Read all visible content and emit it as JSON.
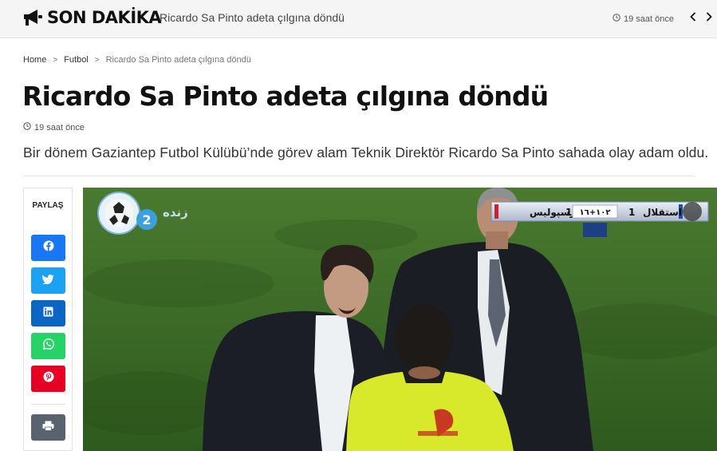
{
  "breaking": {
    "label": "SON DAKİKA",
    "headline": "Ricardo Sa Pinto adeta çılgına döndü",
    "time": "19 saat önce",
    "icons": {
      "megaphone": "megaphone-icon",
      "clock": "clock-icon",
      "prev": "chevron-left-icon",
      "next": "chevron-right-icon"
    }
  },
  "breadcrumb": {
    "home": "Home",
    "category": "Futbol",
    "current": "Ricardo Sa Pinto adeta çılgına döndü"
  },
  "article": {
    "title": "Ricardo Sa Pinto adeta çılgına döndü",
    "time": "19 saat önce",
    "summary": "Bir dönem Gaziantep Futbol Külübü’nde görev alam Teknik Direktör Ricardo Sa Pinto sahada olay adam oldu."
  },
  "share": {
    "label": "PAYLAŞ",
    "buttons": [
      {
        "name": "facebook",
        "icon": "facebook-icon",
        "color": "#1877f2"
      },
      {
        "name": "twitter",
        "icon": "twitter-icon",
        "color": "#1da1f2"
      },
      {
        "name": "linkedin",
        "icon": "linkedin-icon",
        "color": "#0a66c2"
      },
      {
        "name": "whatsapp",
        "icon": "whatsapp-icon",
        "color": "#25d366"
      },
      {
        "name": "pinterest",
        "icon": "pinterest-icon",
        "color": "#e60023"
      },
      {
        "name": "print",
        "icon": "print-icon",
        "color": "#5a6270"
      }
    ]
  },
  "photo": {
    "channel_logo_text": "زنده",
    "channel_number": "2",
    "score": {
      "team_left": "پرسپولیس",
      "team_right": "استقلال",
      "score_left": "1",
      "score_right": "1",
      "clock": "١٠٢+١٦"
    }
  },
  "colors": {
    "accent": "#111111",
    "facebook": "#1877f2",
    "twitter": "#1da1f2",
    "linkedin": "#0a66c2",
    "whatsapp": "#25d366",
    "pinterest": "#e60023",
    "print": "#5a6270"
  }
}
